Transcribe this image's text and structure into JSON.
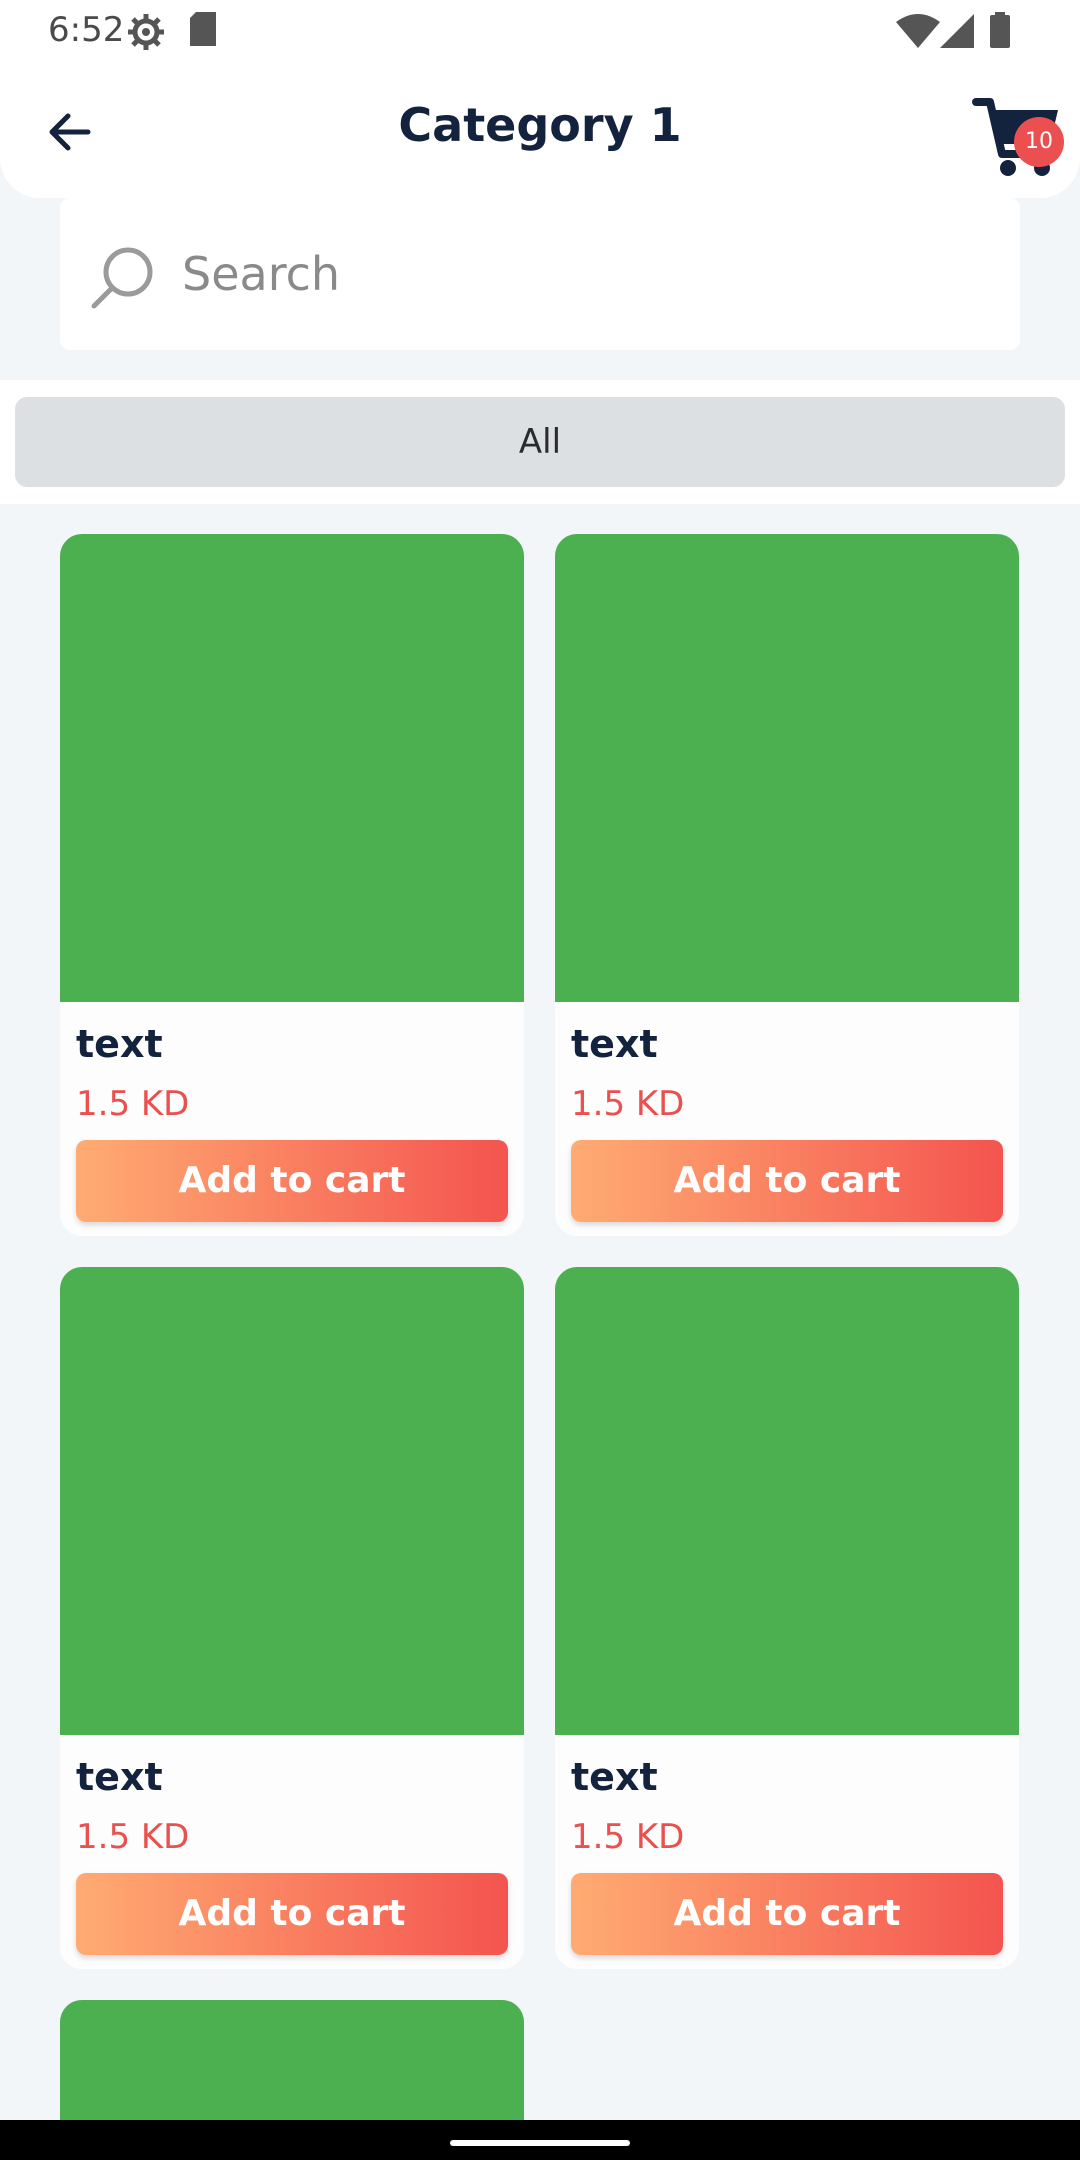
{
  "status_bar": {
    "time": "6:52",
    "icons": [
      "settings-icon",
      "sd-card-icon",
      "wifi-icon",
      "cellular-icon",
      "battery-icon"
    ]
  },
  "header": {
    "title": "Category 1",
    "back_icon": "arrow-left-icon",
    "cart_icon": "shopping-cart-icon",
    "cart_count": "10"
  },
  "search": {
    "placeholder": "Search"
  },
  "filter": {
    "selected": "All"
  },
  "products": [
    {
      "name": "text",
      "price": "1.5 KD",
      "button": "Add to cart"
    },
    {
      "name": "text",
      "price": "1.5 KD",
      "button": "Add to cart"
    },
    {
      "name": "text",
      "price": "1.5 KD",
      "button": "Add to cart"
    },
    {
      "name": "text",
      "price": "1.5 KD",
      "button": "Add to cart"
    }
  ],
  "colors": {
    "accent_red": "#e9504e",
    "image_placeholder": "#4caf50",
    "button_gradient_start": "#ffab72",
    "button_gradient_end": "#f4544f",
    "title_dark": "#13233d"
  }
}
